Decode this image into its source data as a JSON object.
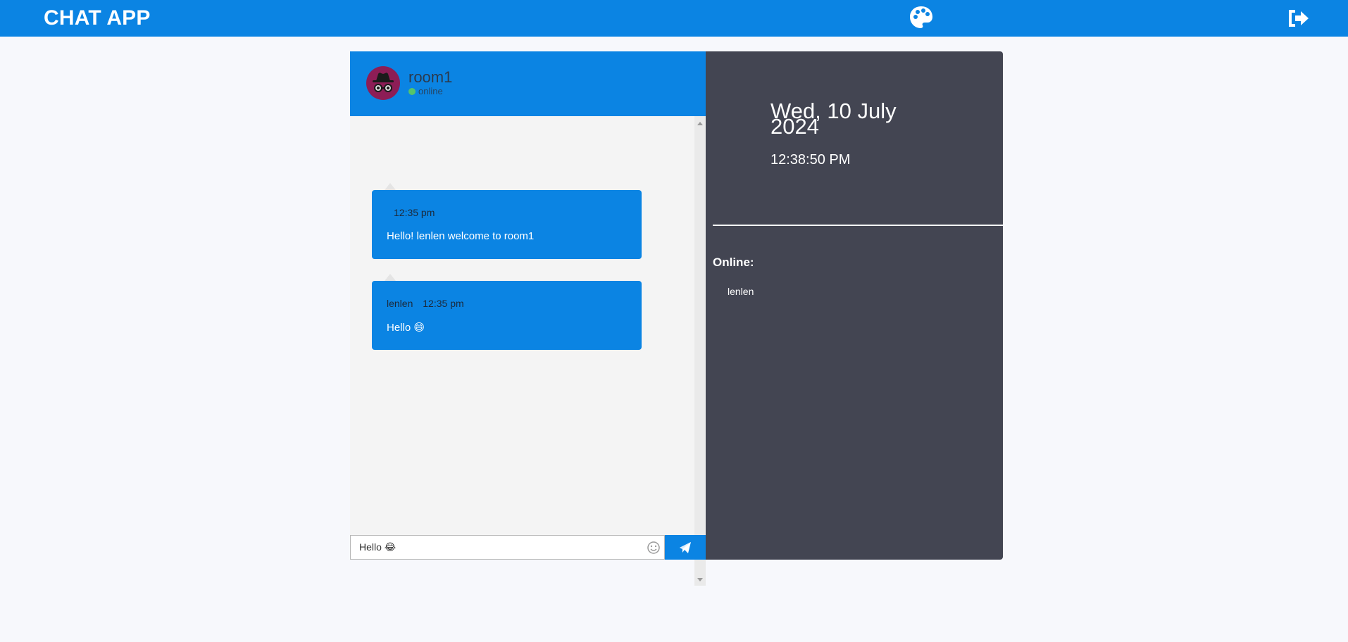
{
  "header": {
    "title": "CHAT APP",
    "theme_icon": "palette-icon",
    "logout_icon": "sign-out-icon"
  },
  "chat": {
    "room_name": "room1",
    "status": "online",
    "avatar_icon": "incognito-icon",
    "messages": [
      {
        "sender": "",
        "time": "12:35 pm",
        "text": "Hello! lenlen welcome to room1"
      },
      {
        "sender": "lenlen",
        "time": "12:35 pm",
        "text": "Hello 😄"
      }
    ],
    "input": {
      "value": "Hello 😂",
      "placeholder": ""
    },
    "emoji_icon": "smile-icon",
    "send_icon": "paper-plane-icon"
  },
  "info": {
    "date": "Wed, 10 July 2024",
    "time": "12:38:50 PM",
    "online_heading": "Online:",
    "online_users": [
      "lenlen"
    ]
  },
  "colors": {
    "primary": "#0b84e3",
    "panel_dark": "#434552",
    "background": "#f7f8fc",
    "avatar": "#8d1d56",
    "online": "#55c46b"
  }
}
